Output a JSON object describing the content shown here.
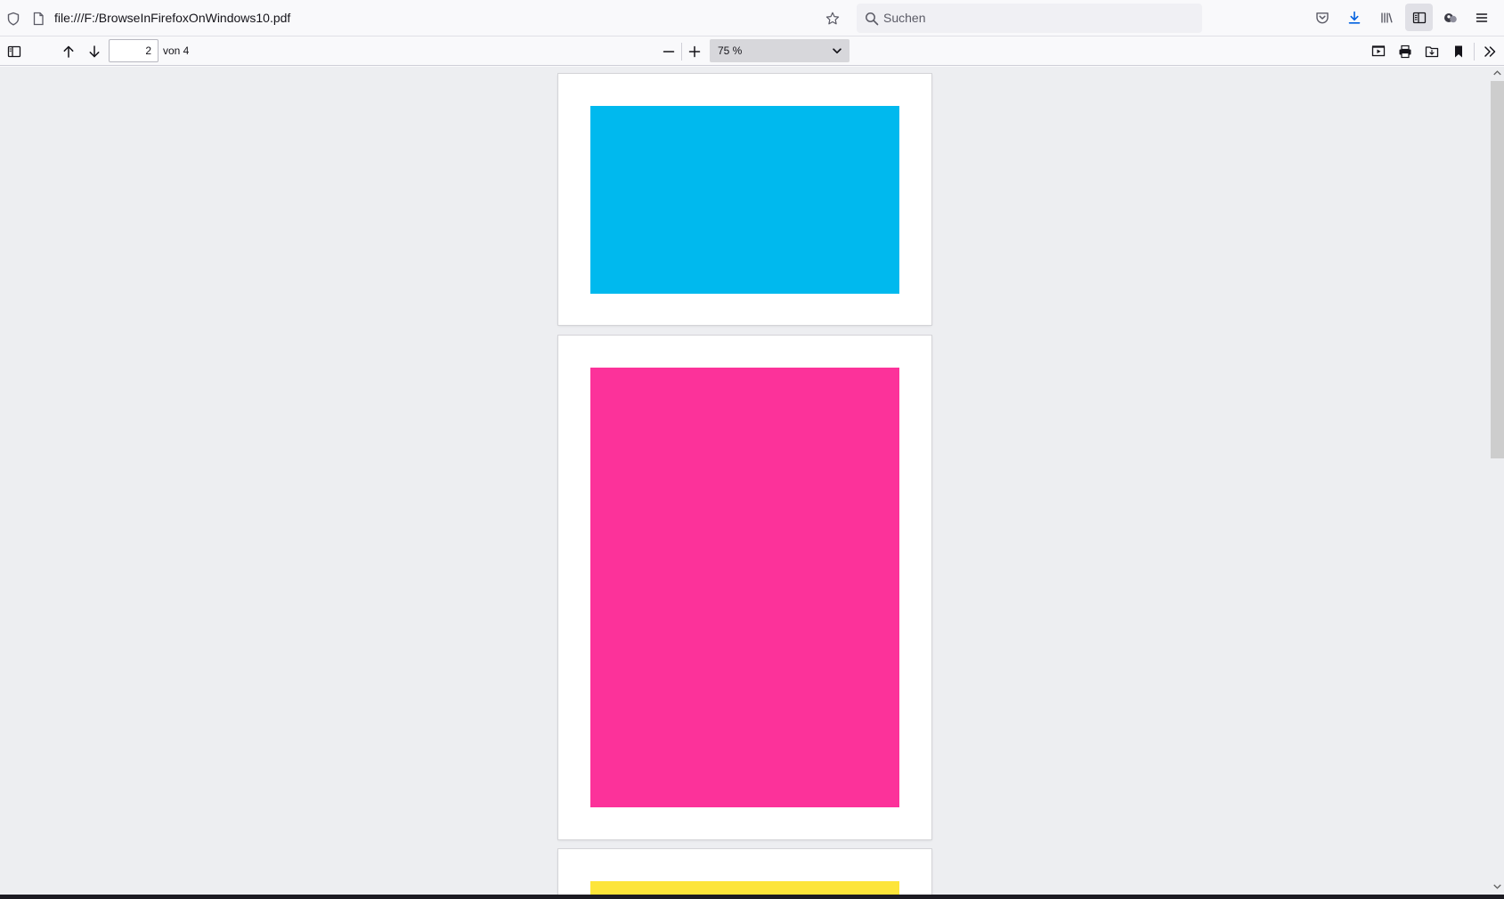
{
  "browser": {
    "url": "file:///F:/BrowseInFirefoxOnWindows10.pdf",
    "search_placeholder": "Suchen",
    "icons": [
      "shield-icon",
      "page-icon",
      "bookmark-star-icon",
      "search-icon",
      "pocket-icon",
      "download-icon",
      "library-icon",
      "sidebar-icon",
      "account-icon",
      "menu-icon"
    ]
  },
  "pdf_toolbar": {
    "current_page": "2",
    "page_total": "von 4",
    "zoom": "75 %",
    "icons": [
      "sidebar-toggle-icon",
      "previous-page-icon",
      "next-page-icon",
      "zoom-out-icon",
      "zoom-in-icon",
      "presentation-mode-icon",
      "print-icon",
      "save-icon",
      "bookmark-icon",
      "more-tools-icon"
    ]
  },
  "document": {
    "pages": [
      {
        "page": 1,
        "fill": "#00b9ee"
      },
      {
        "page": 2,
        "fill": "#fc329a"
      },
      {
        "page": 3,
        "fill": "#fde53a"
      }
    ]
  }
}
